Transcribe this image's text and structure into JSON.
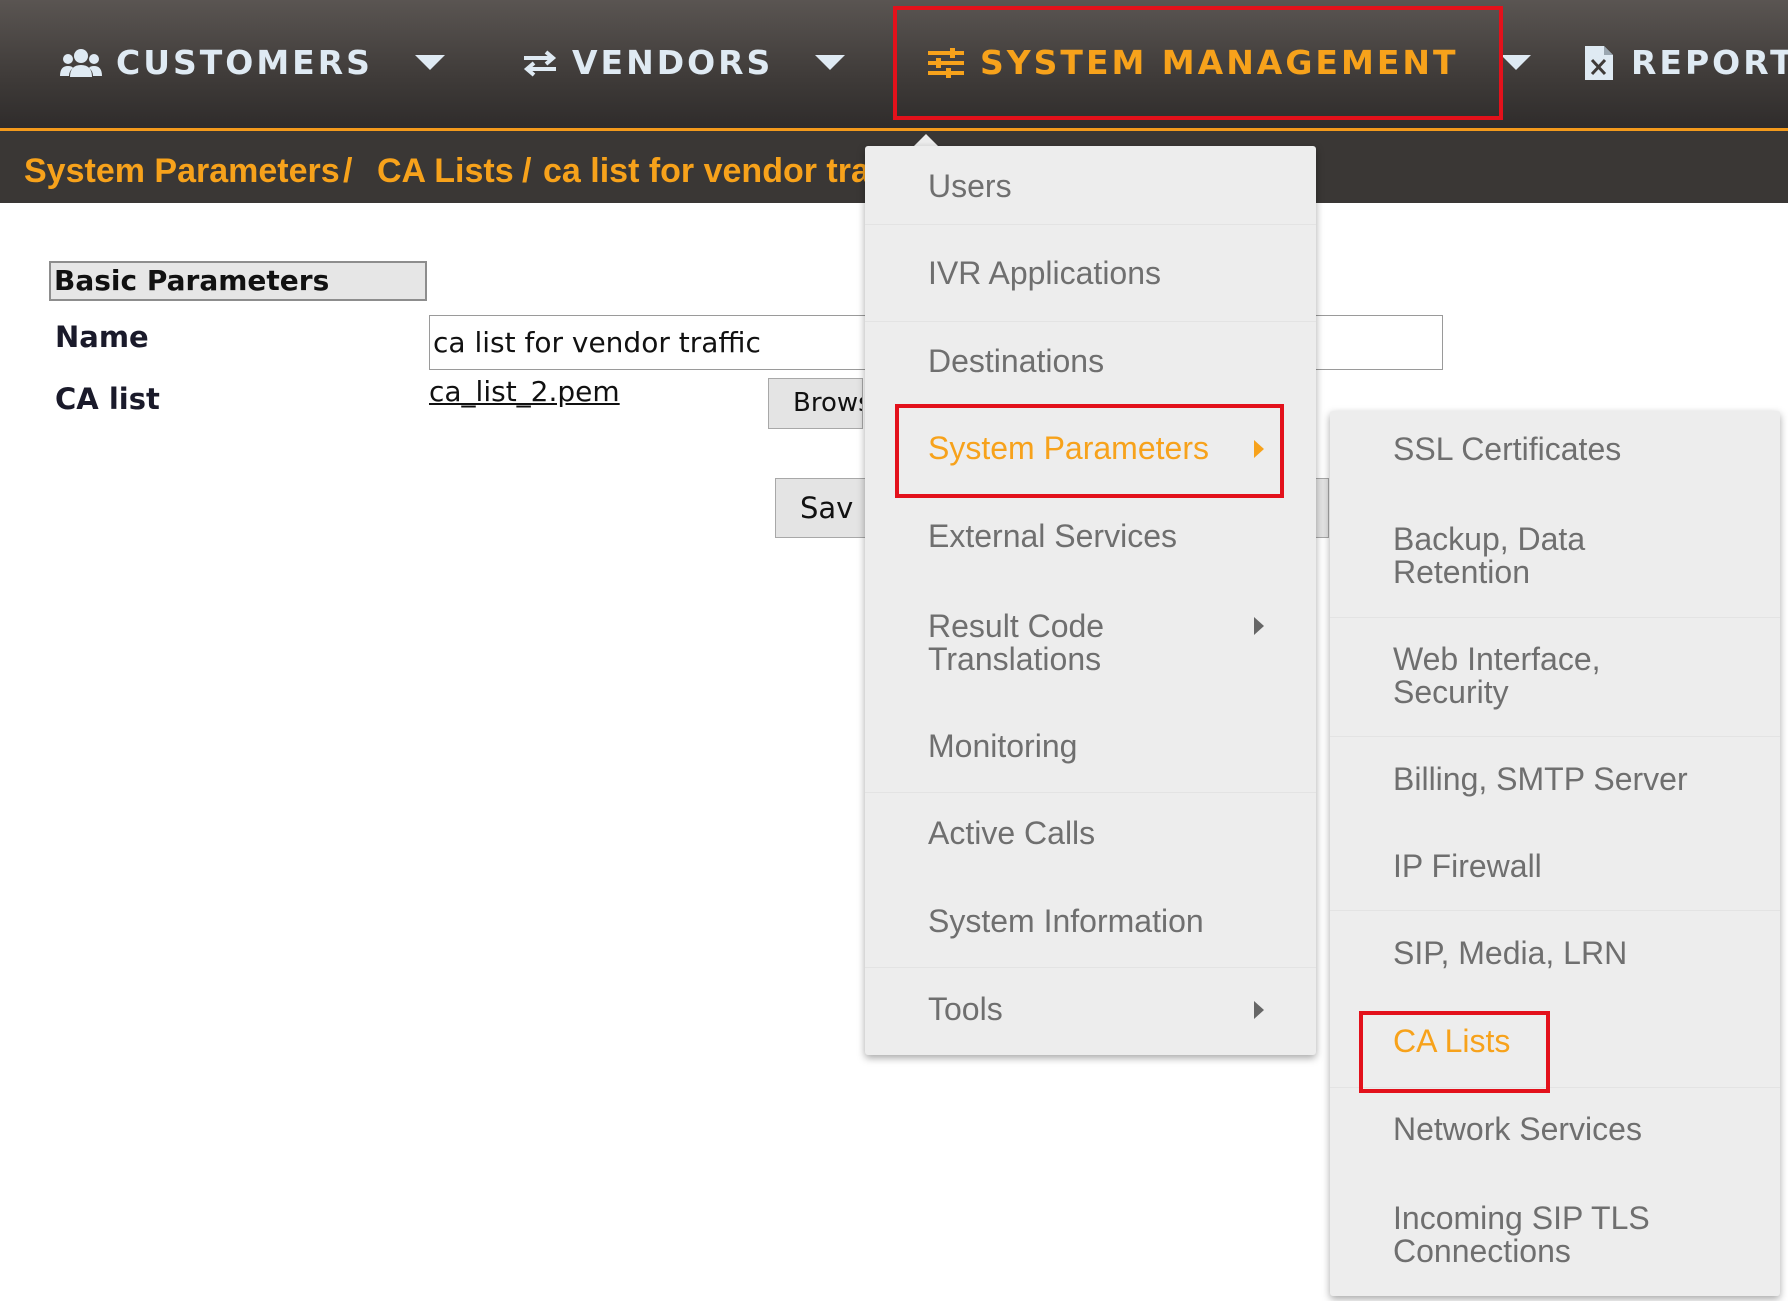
{
  "nav": {
    "items": [
      {
        "label": "CUSTOMERS",
        "icon": "users-icon"
      },
      {
        "label": "VENDORS",
        "icon": "arrows-exchange-icon"
      },
      {
        "label": "SYSTEM MANAGEMENT",
        "icon": "sliders-icon"
      },
      {
        "label": "REPORTS",
        "icon": "excel-file-icon"
      }
    ],
    "active_index": 2
  },
  "breadcrumb": {
    "items": [
      "System Parameters",
      "CA Lists",
      "ca list for vendor tra"
    ],
    "separator": "/"
  },
  "form": {
    "section_title": "Basic Parameters",
    "name_label": "Name",
    "name_value": "ca list for vendor traffic",
    "ca_list_label": "CA list",
    "ca_list_file": "ca_list_2.pem",
    "browse_label": "Brows",
    "save_label": "Sav"
  },
  "system_menu": {
    "items": [
      {
        "label": "Users",
        "submenu": false
      },
      {
        "label": "IVR Applications",
        "submenu": false
      },
      {
        "label": "Destinations",
        "submenu": false
      },
      {
        "label": "System Parameters",
        "submenu": true,
        "selected": true
      },
      {
        "label": "External Services",
        "submenu": false
      },
      {
        "label": "Result Code Translations",
        "submenu": true
      },
      {
        "label": "Monitoring",
        "submenu": false
      },
      {
        "label": "Active Calls",
        "submenu": false
      },
      {
        "label": "System Information",
        "submenu": false
      },
      {
        "label": "Tools",
        "submenu": true
      }
    ]
  },
  "params_menu": {
    "items": [
      {
        "label": "SSL Certificates"
      },
      {
        "label": "Backup, Data Retention"
      },
      {
        "label": "Web Interface, Security"
      },
      {
        "label": "Billing, SMTP Server"
      },
      {
        "label": "IP Firewall"
      },
      {
        "label": "SIP, Media, LRN"
      },
      {
        "label": "CA Lists",
        "selected": true
      },
      {
        "label": "Network Services"
      },
      {
        "label": "Incoming SIP TLS Connections"
      }
    ]
  },
  "colors": {
    "accent": "#f7a21b",
    "highlight_box": "#e3111b",
    "nav_text": "#dfeaf3"
  }
}
